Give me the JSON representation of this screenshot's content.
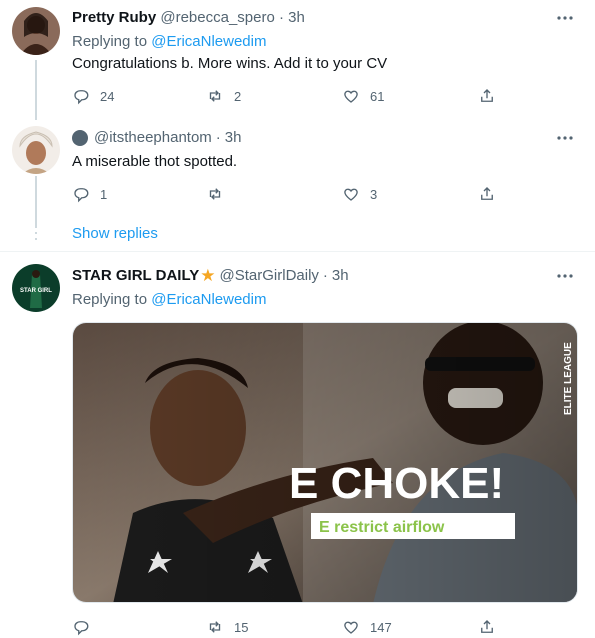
{
  "tweets": [
    {
      "name": "Pretty Ruby",
      "handle": "@rebecca_spero",
      "sep": "·",
      "time": "3h",
      "replying_prefix": "Replying to",
      "replying_handle": "@EricaNlewedim",
      "text": "Congratulations b. More wins. Add it to your CV",
      "replies": "24",
      "retweets": "2",
      "likes": "61"
    },
    {
      "handle": "@itstheephantom",
      "sep": "·",
      "time": "3h",
      "text": "A miserable thot spotted.",
      "replies": "1",
      "retweets": "",
      "likes": "3"
    },
    {
      "name": "STAR GIRL DAILY",
      "badge": "★",
      "handle": "@StarGirlDaily",
      "sep": "·",
      "time": "3h",
      "replying_prefix": "Replying to",
      "replying_handle": "@EricaNlewedim",
      "replies": "",
      "retweets": "15",
      "likes": "147",
      "media": {
        "headline": "E CHOKE!",
        "subline": "E restrict airflow",
        "watermark": "ELITE LEAGUE"
      }
    }
  ],
  "show_replies": "Show replies",
  "colors": {
    "accent": "#1d9bf0",
    "muted": "#536471",
    "divider": "#eff3f4",
    "thread": "#cfd9de",
    "badge": "#f5a623",
    "media_green": "#8bc34a"
  },
  "icons": [
    "more-icon",
    "reply-icon",
    "retweet-icon",
    "like-icon",
    "share-icon",
    "star-badge-icon"
  ]
}
